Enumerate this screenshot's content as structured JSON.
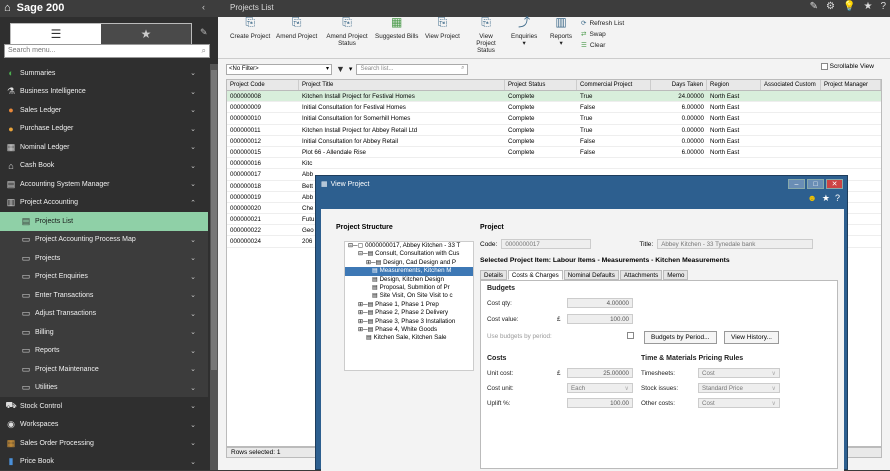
{
  "app": {
    "title": "Sage 200",
    "collapse": "‹",
    "page_heading": "Projects List"
  },
  "top_icons": [
    "✎",
    "⚙",
    "💡",
    "★",
    "?"
  ],
  "sidebar": {
    "search_placeholder": "Search menu...",
    "items": [
      {
        "label": "Summaries",
        "icon": "◐",
        "icon_color": "#4caf50",
        "sub": false
      },
      {
        "label": "Business Intelligence",
        "icon": "⚗",
        "icon_color": "#ddd",
        "sub": false
      },
      {
        "label": "Sales Ledger",
        "icon": "●",
        "icon_color": "#e8883a",
        "sub": false
      },
      {
        "label": "Purchase Ledger",
        "icon": "●",
        "icon_color": "#e8a33a",
        "sub": false
      },
      {
        "label": "Nominal Ledger",
        "icon": "▦",
        "icon_color": "#ddd",
        "sub": false
      },
      {
        "label": "Cash Book",
        "icon": "⌂",
        "icon_color": "#ddd",
        "sub": false
      },
      {
        "label": "Accounting System Manager",
        "icon": "▤",
        "icon_color": "#ddd",
        "sub": false
      },
      {
        "label": "Project Accounting",
        "icon": "▥",
        "icon_color": "#ddd",
        "sub": false,
        "open": true
      },
      {
        "label": "Projects List",
        "icon": "▤",
        "icon_color": "#333",
        "sub": true,
        "selected": true
      },
      {
        "label": "Project Accounting Process Map",
        "icon": "▭",
        "icon_color": "#ddd",
        "sub": true
      },
      {
        "label": "Projects",
        "icon": "▭",
        "icon_color": "#ddd",
        "sub": true
      },
      {
        "label": "Project Enquiries",
        "icon": "▭",
        "icon_color": "#ddd",
        "sub": true
      },
      {
        "label": "Enter Transactions",
        "icon": "▭",
        "icon_color": "#ddd",
        "sub": true
      },
      {
        "label": "Adjust Transactions",
        "icon": "▭",
        "icon_color": "#ddd",
        "sub": true
      },
      {
        "label": "Billing",
        "icon": "▭",
        "icon_color": "#ddd",
        "sub": true
      },
      {
        "label": "Reports",
        "icon": "▭",
        "icon_color": "#ddd",
        "sub": true
      },
      {
        "label": "Project Maintenance",
        "icon": "▭",
        "icon_color": "#ddd",
        "sub": true
      },
      {
        "label": "Utilities",
        "icon": "▭",
        "icon_color": "#ddd",
        "sub": true
      },
      {
        "label": "Stock Control",
        "icon": "⛟",
        "icon_color": "#ddd",
        "sub": false
      },
      {
        "label": "Workspaces",
        "icon": "◉",
        "icon_color": "#ddd",
        "sub": false
      },
      {
        "label": "Sales Order Processing",
        "icon": "▦",
        "icon_color": "#e8a33a",
        "sub": false
      },
      {
        "label": "Price Book",
        "icon": "▮",
        "icon_color": "#4a90d9",
        "sub": false
      }
    ]
  },
  "toolbar": {
    "buttons": [
      {
        "label": "Create Project",
        "icon": "⎘"
      },
      {
        "label": "Amend Project",
        "icon": "⎘"
      },
      {
        "label": "Amend Project Status",
        "icon": "⎘"
      },
      {
        "label": "Suggested Bills",
        "icon": "▦"
      },
      {
        "label": "View Project",
        "icon": "⎘"
      },
      {
        "label": "View Project Status",
        "icon": "⎘"
      },
      {
        "label": "Enquiries",
        "icon": "⤴"
      },
      {
        "label": "Reports",
        "icon": "▥"
      }
    ],
    "refresh": "Refresh List",
    "swap": "Swap",
    "clear": "Clear"
  },
  "filter": {
    "value": "<No Filter>",
    "search_placeholder": "Search list...",
    "scrollable": "Scrollable View"
  },
  "grid": {
    "columns": [
      "Project Code",
      "Project Title",
      "Project Status",
      "Commercial Project",
      "Days Taken",
      "Region",
      "Associated Custom",
      "Project Manager"
    ],
    "rows": [
      {
        "code": "000000008",
        "title": "Kitchen Install Project for Festival Homes",
        "status": "Complete",
        "commercial": "True",
        "days": "24.00000",
        "region": "North East"
      },
      {
        "code": "000000009",
        "title": "Initial Consultation for Festival Homes",
        "status": "Complete",
        "commercial": "False",
        "days": "6.00000",
        "region": "North East"
      },
      {
        "code": "000000010",
        "title": "Initial Consultation for Somerhill Homes",
        "status": "Complete",
        "commercial": "True",
        "days": "0.00000",
        "region": "North East"
      },
      {
        "code": "000000011",
        "title": "Kitchen Install Project for Abbey Retail Ltd",
        "status": "Complete",
        "commercial": "True",
        "days": "0.00000",
        "region": "North East"
      },
      {
        "code": "000000012",
        "title": "Initial Consultation for Abbey Retail",
        "status": "Complete",
        "commercial": "False",
        "days": "0.00000",
        "region": "North East"
      },
      {
        "code": "000000015",
        "title": "Plot 66 - Allendale Rise",
        "status": "Complete",
        "commercial": "False",
        "days": "6.00000",
        "region": "North East"
      },
      {
        "code": "000000016",
        "title": "Kitc",
        "status": "",
        "commercial": "",
        "days": "",
        "region": ""
      },
      {
        "code": "000000017",
        "title": "Abb",
        "status": "",
        "commercial": "",
        "days": "",
        "region": ""
      },
      {
        "code": "000000018",
        "title": "Bett",
        "status": "",
        "commercial": "",
        "days": "",
        "region": ""
      },
      {
        "code": "000000019",
        "title": "Abb",
        "status": "",
        "commercial": "",
        "days": "",
        "region": ""
      },
      {
        "code": "000000020",
        "title": "Che",
        "status": "",
        "commercial": "",
        "days": "",
        "region": ""
      },
      {
        "code": "000000021",
        "title": "Futu",
        "status": "",
        "commercial": "",
        "days": "",
        "region": ""
      },
      {
        "code": "000000022",
        "title": "Geo",
        "status": "",
        "commercial": "",
        "days": "",
        "region": ""
      },
      {
        "code": "000000024",
        "title": "206",
        "status": "",
        "commercial": "",
        "days": "",
        "region": ""
      }
    ],
    "status": "Rows selected: 1"
  },
  "dialog": {
    "title": "View Project",
    "structure_title": "Project Structure",
    "tree": [
      {
        "text": "⊟─▢ 0000000017, Abbey Kitchen - 33 T",
        "indent": 0
      },
      {
        "text": "⊟─▤ Consult, Consultation with Cus",
        "indent": 10
      },
      {
        "text": "⊞─▤ Design, Cad Design and P",
        "indent": 18
      },
      {
        "text": "▤ Measurements, Kitchen M",
        "indent": 24,
        "selected": true
      },
      {
        "text": "▤ Design, Kitchen Design",
        "indent": 24
      },
      {
        "text": "▤ Proposal, Submition of Pr",
        "indent": 24
      },
      {
        "text": "▤ Site Visit, On Site Visit to c",
        "indent": 24
      },
      {
        "text": "⊞─▤ Phase 1, Phase 1 Prep",
        "indent": 10
      },
      {
        "text": "⊞─▤ Phase 2, Phase 2 Delivery",
        "indent": 10
      },
      {
        "text": "⊞─▤ Phase 3, Phase 3 Installation",
        "indent": 10
      },
      {
        "text": "⊞─▤ Phase 4, White Goods",
        "indent": 10
      },
      {
        "text": "▤ Kitchen Sale, Kitchen Sale",
        "indent": 18
      }
    ],
    "project_title": "Project",
    "code_label": "Code:",
    "code_value": "0000000017",
    "title_label": "Title:",
    "title_value": "Abbey Kitchen - 33 Tynedale bank",
    "selected_item": "Selected Project Item: Labour Items - Measurements - Kitchen Measurements",
    "tabs": [
      "Details",
      "Costs & Charges",
      "Nominal Defaults",
      "Attachments",
      "Memo"
    ],
    "budgets_header": "Budgets",
    "cost_qty_label": "Cost qty:",
    "cost_qty": "4.00000",
    "cost_value_label": "Cost value:",
    "currency": "£",
    "cost_value": "100.00",
    "use_budgets": "Use budgets by period:",
    "budgets_by_period": "Budgets by Period...",
    "view_history": "View History...",
    "costs_header": "Costs",
    "unit_cost_label": "Unit cost:",
    "unit_cost": "25.00000",
    "cost_unit_label": "Cost unit:",
    "cost_unit": "Each",
    "uplift_label": "Uplift %:",
    "uplift": "100.00",
    "tm_header": "Time & Materials Pricing Rules",
    "timesheets_label": "Timesheets:",
    "timesheets": "Cost",
    "stock_label": "Stock issues:",
    "stock": "Standard Price",
    "other_label": "Other costs:",
    "other": "Cost"
  }
}
